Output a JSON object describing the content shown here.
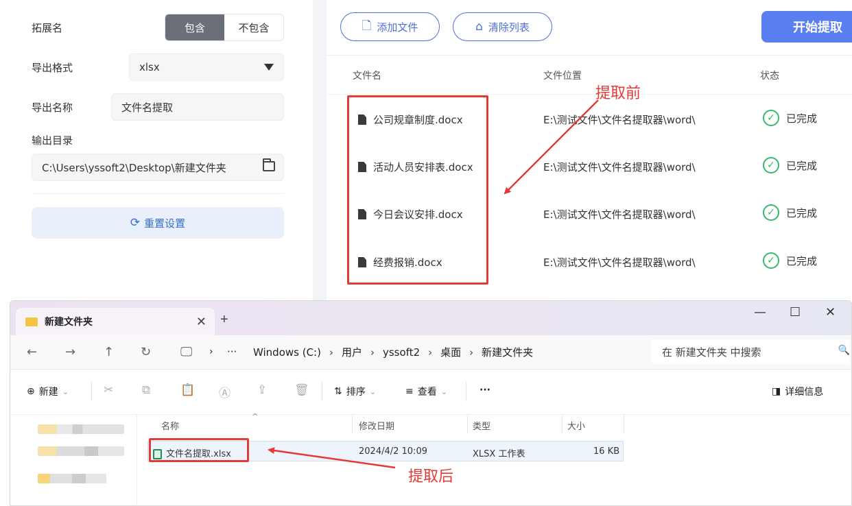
{
  "left": {
    "ext_label": "拓展名",
    "include": "包含",
    "exclude": "不包含",
    "format_label": "导出格式",
    "format_value": "xlsx",
    "name_label": "导出名称",
    "name_value": "文件名提取",
    "dir_label": "输出目录",
    "dir_value": "C:\\Users\\yssoft2\\Desktop\\新建文件夹",
    "reset": "重置设置"
  },
  "toolbar": {
    "add_file": "添加文件",
    "clear_list": "清除列表",
    "start": "开始提取"
  },
  "table": {
    "headers": [
      "文件名",
      "文件位置",
      "状态"
    ],
    "rows": [
      {
        "name": "公司规章制度.docx",
        "path": "E:\\测试文件\\文件名提取器\\word\\",
        "status": "已完成"
      },
      {
        "name": "活动人员安排表.docx",
        "path": "E:\\测试文件\\文件名提取器\\word\\",
        "status": "已完成"
      },
      {
        "name": "今日会议安排.docx",
        "path": "E:\\测试文件\\文件名提取器\\word\\",
        "status": "已完成"
      },
      {
        "name": "经费报销.docx",
        "path": "E:\\测试文件\\文件名提取器\\word\\",
        "status": "已完成"
      }
    ]
  },
  "annotations": {
    "before": "提取前",
    "after": "提取后",
    "color": "#e53935"
  },
  "explorer": {
    "tab_title": "新建文件夹",
    "breadcrumbs": [
      "Windows (C:)",
      "用户",
      "yssoft2",
      "桌面",
      "新建文件夹"
    ],
    "search_placeholder": "在 新建文件夹 中搜索",
    "new": "新建",
    "sort": "排序",
    "view": "查看",
    "more": "···",
    "details": "详细信息",
    "columns": [
      "名称",
      "修改日期",
      "类型",
      "大小"
    ],
    "file": {
      "name": "文件名提取.xlsx",
      "modified": "2024/4/2 10:09",
      "type": "XLSX 工作表",
      "size": "16 KB"
    }
  },
  "colors": {
    "accent": "#4f6fd8",
    "start_button": "#5b7ff0",
    "success": "#35b86b"
  }
}
